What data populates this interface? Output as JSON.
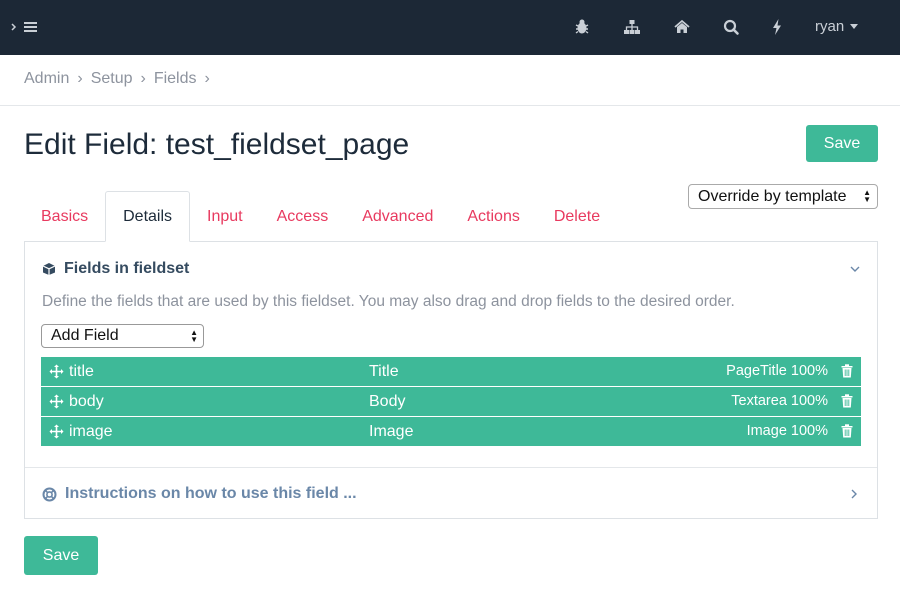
{
  "topbar": {
    "icons": [
      "bug-icon",
      "sitemap-icon",
      "home-icon",
      "search-icon",
      "bolt-icon"
    ],
    "user": "ryan"
  },
  "breadcrumb": [
    "Admin",
    "Setup",
    "Fields"
  ],
  "page_title": "Edit Field: test_fieldset_page",
  "save_label": "Save",
  "template_select": "Override by template",
  "tabs": [
    "Basics",
    "Details",
    "Input",
    "Access",
    "Advanced",
    "Actions",
    "Delete"
  ],
  "active_tab": "Details",
  "section": {
    "title": "Fields in fieldset",
    "description": "Define the fields that are used by this fieldset. You may also drag and drop fields to the desired order.",
    "add_field": "Add Field",
    "fields": [
      {
        "name": "title",
        "label": "Title",
        "meta": "PageTitle 100%"
      },
      {
        "name": "body",
        "label": "Body",
        "meta": "Textarea 100%"
      },
      {
        "name": "image",
        "label": "Image",
        "meta": "Image 100%"
      }
    ],
    "instructions": "Instructions on how to use this field ..."
  },
  "colors": {
    "accent": "#3eb998",
    "tab_link": "#e83a5f",
    "topbar": "#1c2836"
  }
}
